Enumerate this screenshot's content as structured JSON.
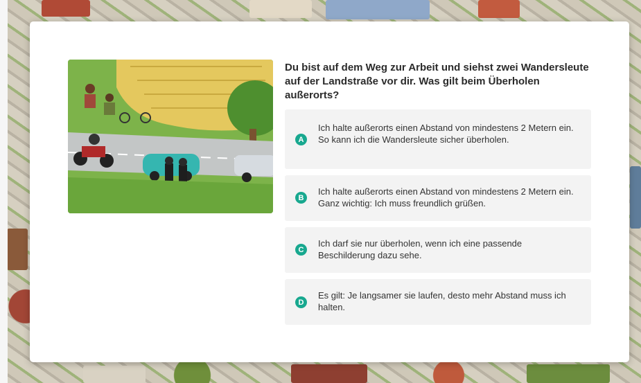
{
  "question": {
    "text": "Du bist auf dem Weg zur Arbeit und siehst zwei Wandersleute auf der Landstraße vor dir. Was gilt beim Überholen außerorts?"
  },
  "answers": [
    {
      "letter": "A",
      "text": "Ich halte außerorts einen Abstand von mindestens 2 Metern ein. So kann ich die Wandersleute sicher überholen."
    },
    {
      "letter": "B",
      "text": "Ich halte außerorts einen Abstand von mindestens 2 Metern ein. Ganz wichtig: Ich muss freundlich grüßen."
    },
    {
      "letter": "C",
      "text": "Ich darf sie nur überholen, wenn ich eine passende Beschilderung dazu sehe."
    },
    {
      "letter": "D",
      "text": "Es gilt: Je langsamer sie laufen, desto mehr Abstand muss ich halten."
    }
  ],
  "colors": {
    "accent": "#18a88f",
    "answer_bg": "#f3f3f3",
    "card_bg": "#ffffff"
  }
}
